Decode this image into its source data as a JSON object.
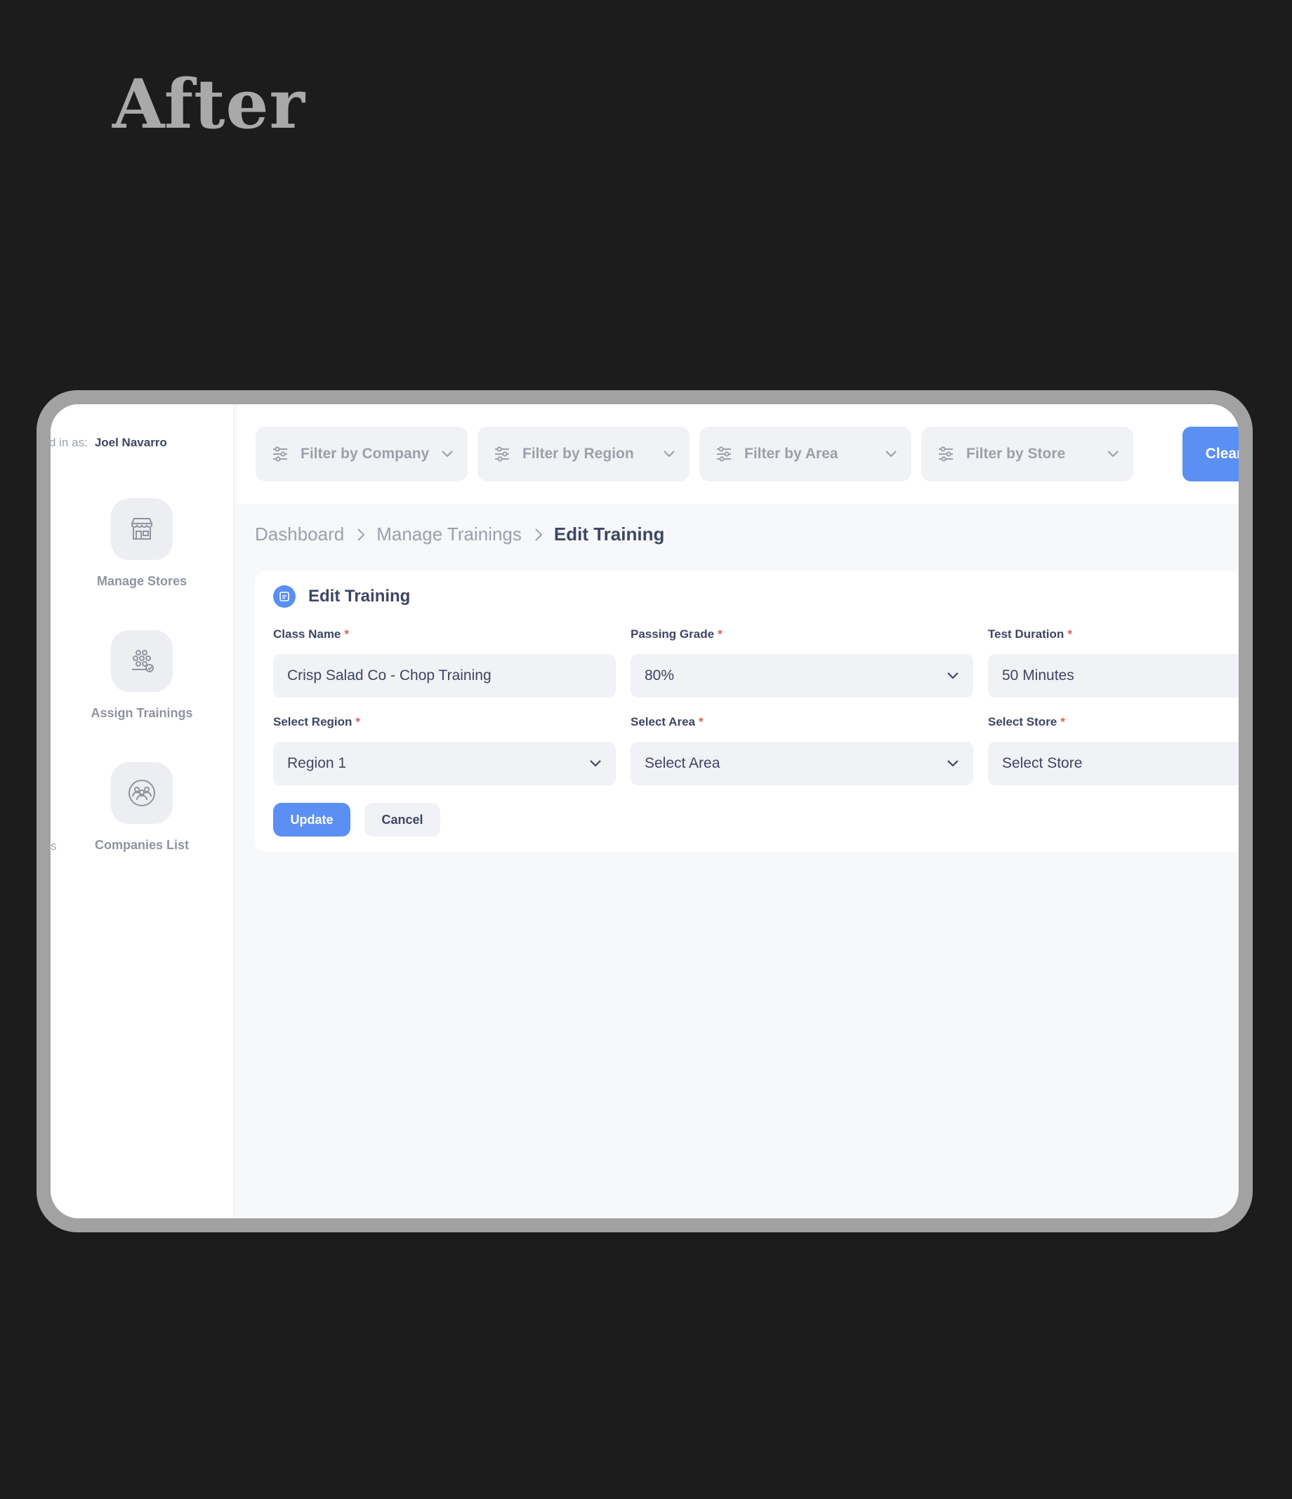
{
  "heading": "After",
  "session": {
    "logged_in_prefix": "d in as:",
    "user_name": "Joel Navarro"
  },
  "sidebar": {
    "items": [
      {
        "label": "Manage Stores",
        "icon": "store-icon"
      },
      {
        "label": "Assign Trainings",
        "icon": "group-check-icon"
      },
      {
        "label": "Companies List",
        "icon": "companies-icon"
      }
    ],
    "cut_text": "s"
  },
  "filters": [
    {
      "label": "Filter by Company",
      "icon": "sliders-icon"
    },
    {
      "label": "Filter by Region",
      "icon": "sliders-icon"
    },
    {
      "label": "Filter by Area",
      "icon": "sliders-icon"
    },
    {
      "label": "Filter by Store",
      "icon": "sliders-icon"
    }
  ],
  "clear_label": "Clear",
  "breadcrumb": [
    "Dashboard",
    "Manage Trainings",
    "Edit Training"
  ],
  "form": {
    "title": "Edit Training",
    "required_mark": "*",
    "fields": [
      {
        "label": "Class Name",
        "value": "Crisp Salad Co - Chop Training",
        "type": "text"
      },
      {
        "label": "Passing Grade",
        "value": "80%",
        "type": "select"
      },
      {
        "label": "Test Duration",
        "value": "50 Minutes",
        "type": "text"
      },
      {
        "label": "Select Region",
        "value": "Region 1",
        "type": "select"
      },
      {
        "label": "Select Area",
        "value": "Select Area",
        "type": "select"
      },
      {
        "label": "Select Store",
        "value": "Select Store",
        "type": "select"
      }
    ],
    "update_label": "Update",
    "cancel_label": "Cancel"
  },
  "colors": {
    "accent": "#5b8ff3",
    "text_dark": "#3d4663",
    "text_muted": "#9aa0ab",
    "required": "#e05a5a",
    "page_bg": "#1c1c1c",
    "frame": "#a2a2a2"
  }
}
